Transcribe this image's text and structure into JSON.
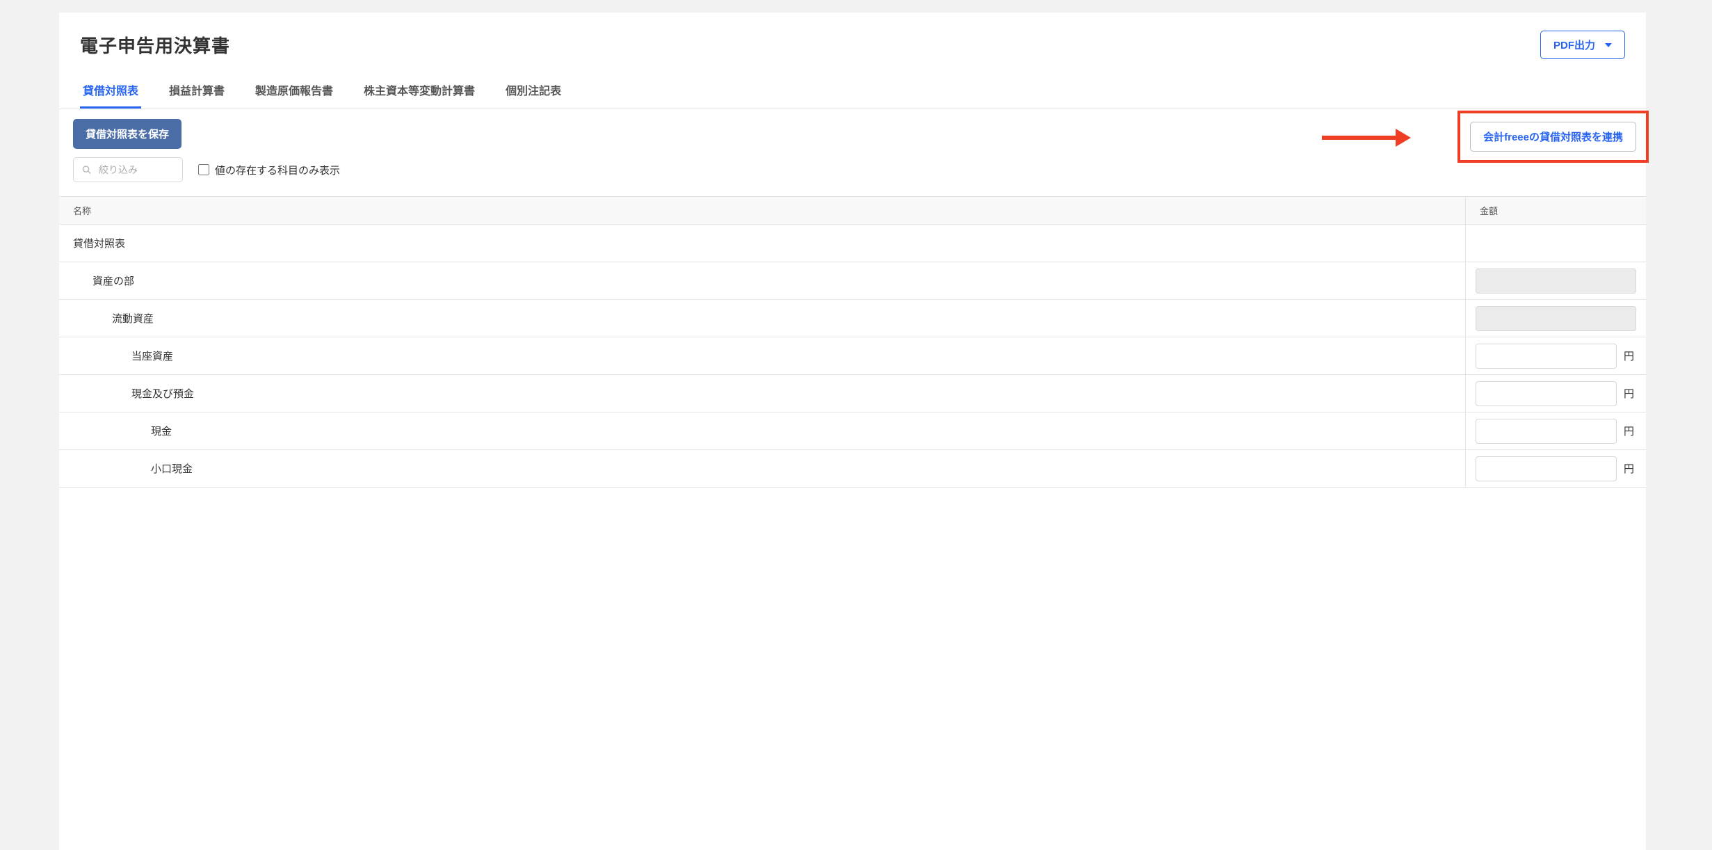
{
  "header": {
    "title": "電子申告用決算書",
    "pdf_button": "PDF出力"
  },
  "tabs": [
    {
      "label": "貸借対照表",
      "active": true
    },
    {
      "label": "損益計算書",
      "active": false
    },
    {
      "label": "製造原価報告書",
      "active": false
    },
    {
      "label": "株主資本等変動計算書",
      "active": false
    },
    {
      "label": "個別注記表",
      "active": false
    }
  ],
  "toolbar": {
    "save_label": "貸借対照表を保存",
    "search_placeholder": "絞り込み",
    "checkbox_label": "値の存在する科目のみ表示",
    "link_button_label": "会計freeeの貸借対照表を連携"
  },
  "table": {
    "header_name": "名称",
    "header_amount": "金額",
    "unit_label": "円",
    "rows": [
      {
        "label": "貸借対照表",
        "indent": 0,
        "amount_type": "none"
      },
      {
        "label": "資産の部",
        "indent": 1,
        "amount_type": "readonly"
      },
      {
        "label": "流動資産",
        "indent": 2,
        "amount_type": "readonly"
      },
      {
        "label": "当座資産",
        "indent": 3,
        "amount_type": "input"
      },
      {
        "label": "現金及び預金",
        "indent": 3,
        "amount_type": "input"
      },
      {
        "label": "現金",
        "indent": 4,
        "amount_type": "input"
      },
      {
        "label": "小口現金",
        "indent": 4,
        "amount_type": "input"
      }
    ]
  }
}
